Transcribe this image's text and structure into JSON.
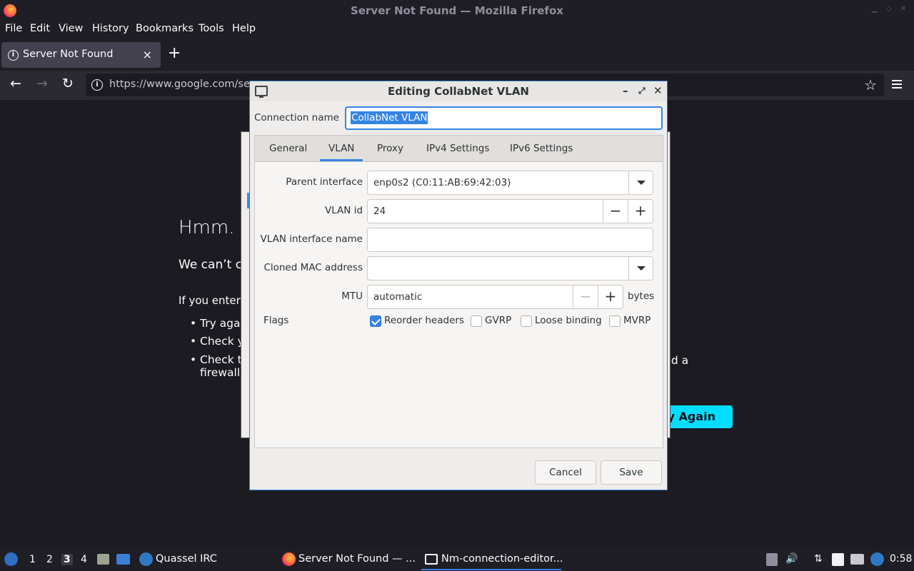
{
  "window": {
    "title": "Server Not Found — Mozilla Firefox"
  },
  "menu": [
    "File",
    "Edit",
    "View",
    "History",
    "Bookmarks",
    "Tools",
    "Help"
  ],
  "tab": {
    "title": "Server Not Found",
    "close": "×",
    "new": "+"
  },
  "nav": {
    "url": "https://www.google.com/sea"
  },
  "page": {
    "heading": "Hmm.",
    "line1": "We can’t c",
    "line2": "If you enter",
    "bullets": [
      "Try aga",
      "Check y",
      "Check t"
    ],
    "bullet3_cont": "firewall",
    "tail": "nd a",
    "try_again": "y Again"
  },
  "dialog": {
    "title": "Editing CollabNet VLAN",
    "connection_name_label": "Connection name",
    "connection_name_value": "CollabNet VLAN",
    "tabs": [
      "General",
      "VLAN",
      "Proxy",
      "IPv4 Settings",
      "IPv6 Settings"
    ],
    "active_tab": "VLAN",
    "parent_interface_label": "Parent interface",
    "parent_interface_value": "enp0s2 (C0:11:AB:69:42:03)",
    "vlan_id_label": "VLAN id",
    "vlan_id_value": "24",
    "vlan_ifname_label": "VLAN interface name",
    "vlan_ifname_value": "",
    "cloned_mac_label": "Cloned MAC address",
    "cloned_mac_value": "",
    "mtu_label": "MTU",
    "mtu_value": "automatic",
    "mtu_unit": "bytes",
    "flags_label": "Flags",
    "flags": [
      {
        "label": "Reorder headers",
        "checked": true
      },
      {
        "label": "GVRP",
        "checked": false
      },
      {
        "label": "Loose binding",
        "checked": false
      },
      {
        "label": "MVRP",
        "checked": false
      }
    ],
    "cancel": "Cancel",
    "save": "Save",
    "minus": "−",
    "plus": "+"
  },
  "taskbar": {
    "workspaces": [
      "1",
      "2",
      "3",
      "4"
    ],
    "current_workspace": "3",
    "tasks": [
      "Quassel IRC",
      "Server Not Found — ...",
      "Nm-connection-editor..."
    ],
    "clock": "0:58"
  },
  "colors": {
    "accent": "#3584e4",
    "try_again": "#00ddff"
  }
}
